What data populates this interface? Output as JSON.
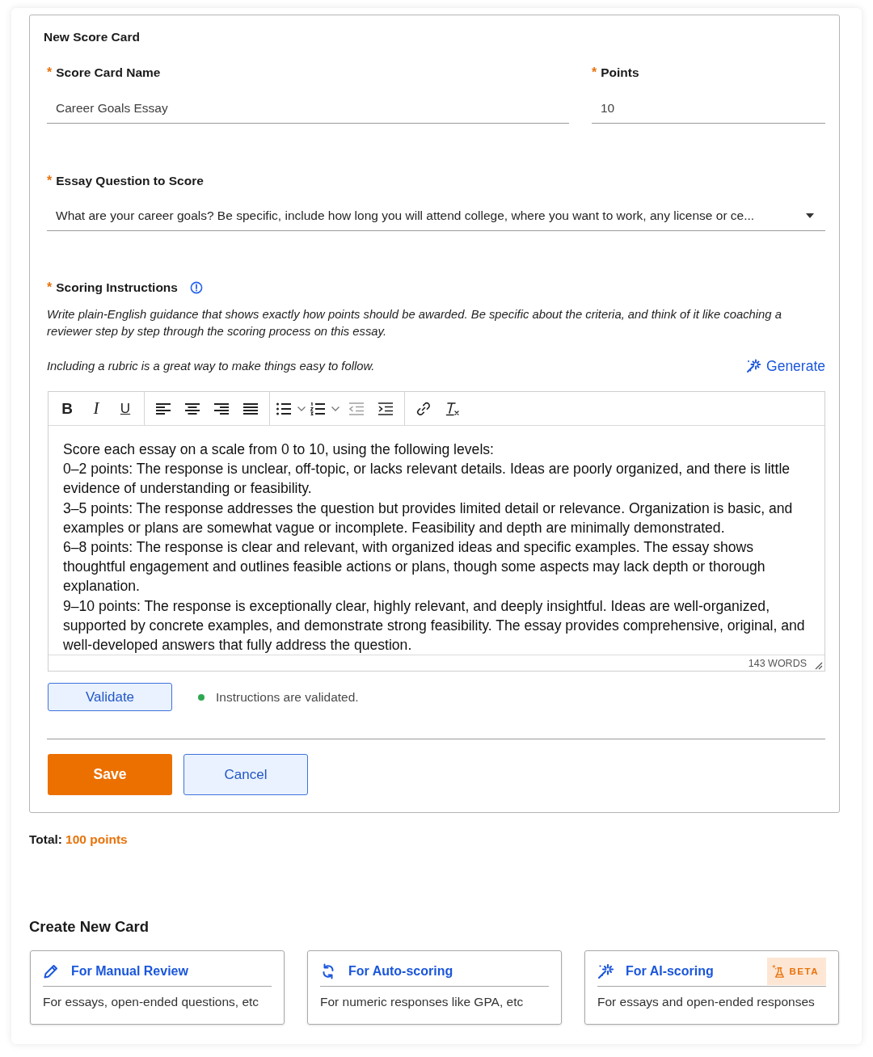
{
  "form": {
    "title": "New Score Card",
    "score_card_name": {
      "required_mark": "*",
      "label": "Score Card Name",
      "value": "Career Goals Essay"
    },
    "points": {
      "required_mark": "*",
      "label": "Points",
      "value": "10"
    },
    "essay_question": {
      "required_mark": "*",
      "label": "Essay Question to Score",
      "value": "What are your career goals? Be specific, include how long you will attend college, where you want to work, any license or ce..."
    },
    "instructions": {
      "required_mark": "*",
      "label": "Scoring Instructions",
      "help": "Write plain-English guidance that shows exactly how points should be awarded. Be specific about the criteria, and think of it like coaching a reviewer step by step through the scoring process on this essay.",
      "hint": "Including a rubric is a great way to make things easy to follow.",
      "generate": "Generate",
      "toolbar": [
        [
          {
            "kind": "bold",
            "label": "B",
            "disabled": false
          },
          {
            "kind": "italic",
            "label": "I",
            "disabled": false
          },
          {
            "kind": "underline",
            "label": "U",
            "disabled": false
          }
        ],
        [
          {
            "kind": "align-left",
            "disabled": false
          },
          {
            "kind": "align-center",
            "disabled": false
          },
          {
            "kind": "align-right",
            "disabled": false
          },
          {
            "kind": "justify",
            "disabled": false
          }
        ],
        [
          {
            "kind": "bullet-list",
            "disabled": false
          },
          {
            "kind": "numbered-list",
            "disabled": false
          },
          {
            "kind": "outdent",
            "disabled": true
          },
          {
            "kind": "indent",
            "disabled": false
          }
        ],
        [
          {
            "kind": "link",
            "disabled": false
          },
          {
            "kind": "clear-format",
            "disabled": false
          }
        ]
      ],
      "paragraphs": [
        "Score each essay on a scale from 0 to 10, using the following levels:",
        "0–2 points: The response is unclear, off-topic, or lacks relevant details. Ideas are poorly organized, and there is little evidence of understanding or feasibility.",
        "3–5 points: The response addresses the question but provides limited detail or relevance. Organization is basic, and examples or plans are somewhat vague or incomplete. Feasibility and depth are minimally demonstrated.",
        "6–8 points: The response is clear and relevant, with organized ideas and specific examples. The essay shows thoughtful engagement and outlines feasible actions or plans, though some aspects may lack depth or thorough explanation.",
        "9–10 points: The response is exceptionally clear, highly relevant, and deeply insightful. Ideas are well-organized, supported by concrete examples, and demonstrate strong feasibility. The essay provides comprehensive, original, and well-developed answers that fully address the question."
      ],
      "word_count": "143 WORDS"
    },
    "validation": {
      "button": "Validate",
      "status": "Instructions are validated.",
      "color": "#2ea84f"
    },
    "actions": [
      {
        "kind": "primary",
        "label": "Save"
      },
      {
        "kind": "secondary",
        "label": "Cancel"
      }
    ]
  },
  "total": {
    "label": "Total:",
    "value": "100 points"
  },
  "create": {
    "title": "Create New Card",
    "cards": [
      {
        "kind": "manual",
        "title": "For Manual Review",
        "description": "For essays, open-ended questions, etc"
      },
      {
        "kind": "auto",
        "title": "For Auto-scoring",
        "description": "For numeric responses like GPA, etc"
      },
      {
        "kind": "ai",
        "title": "For AI-scoring",
        "description": "For essays and open-ended responses",
        "badge": "BETA"
      }
    ]
  }
}
